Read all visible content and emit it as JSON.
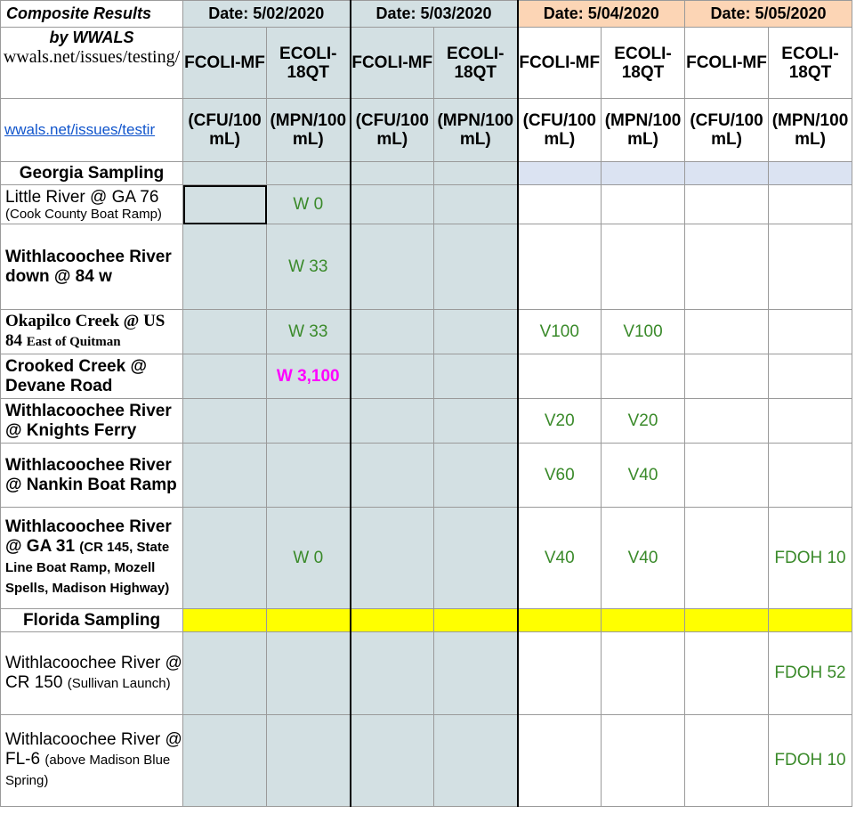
{
  "header": {
    "title": "Composite Results",
    "by_line": "by WWALS",
    "url_text": "wwals.net/issues/testing/",
    "link_text": "wwals.net/issues/testir",
    "dates": [
      "Date:  5/02/2020",
      "Date:  5/03/2020",
      "Date:  5/04/2020",
      "Date:  5/05/2020"
    ],
    "params": [
      "FCOLI-MF",
      "ECOLI-18QT",
      "FCOLI-MF",
      "ECOLI-18QT",
      "FCOLI-MF",
      "ECOLI-18QT",
      "FCOLI-MF",
      "ECOLI-18QT"
    ],
    "units": [
      "(CFU/100 mL)",
      "(MPN/100 mL)",
      "(CFU/100 mL)",
      "(MPN/100 mL)",
      "(CFU/100 mL)",
      "(MPN/100 mL)",
      "(CFU/100 mL)",
      "(MPN/100 mL)"
    ]
  },
  "colors": {
    "blue_column": "#d3e0e3",
    "orange_header": "#fcd5b5",
    "florida_bar": "#ffff00",
    "georgia_bar": "#dbe3f2",
    "value_green": "#3a8a2a",
    "value_magenta": "#ff00ff"
  },
  "sections": {
    "georgia": "Georgia Sampling",
    "florida": "Florida Sampling"
  },
  "sites": [
    {
      "name": "Little River @ GA 76",
      "sub": "(Cook County Boat Ramp)",
      "values": [
        "",
        "W 0",
        "",
        "",
        "",
        "",
        "",
        ""
      ]
    },
    {
      "name": "Withlacoochee River down @ 84 w",
      "sub": "",
      "values": [
        "",
        "W 33",
        "",
        "",
        "",
        "",
        "",
        ""
      ]
    },
    {
      "name": "Okapilco Creek @ US 84",
      "sub": "East of Quitman",
      "values": [
        "",
        "W 33",
        "",
        "",
        "V100",
        "V100",
        "",
        ""
      ]
    },
    {
      "name": "Crooked Creek @ Devane Road",
      "sub": "",
      "values": [
        "",
        "W 3,100",
        "",
        "",
        "",
        "",
        "",
        ""
      ]
    },
    {
      "name": "Withlacoochee River @ Knights Ferry",
      "sub": "",
      "values": [
        "",
        "",
        "",
        "",
        "V20",
        "V20",
        "",
        ""
      ]
    },
    {
      "name": "Withlacoochee River @ Nankin Boat Ramp",
      "sub": "",
      "values": [
        "",
        "",
        "",
        "",
        "V60",
        "V40",
        "",
        ""
      ]
    },
    {
      "name": "Withlacoochee River @ GA 31",
      "sub": "(CR 145, State Line Boat Ramp, Mozell Spells, Madison Highway)",
      "values": [
        "",
        "W 0",
        "",
        "",
        "V40",
        "V40",
        "",
        "FDOH 10"
      ]
    },
    {
      "name": "Withlacoochee River @ CR 150",
      "sub": "(Sullivan Launch)",
      "values": [
        "",
        "",
        "",
        "",
        "",
        "",
        "",
        "FDOH 52"
      ]
    },
    {
      "name": "Withlacoochee River @ FL-6",
      "sub": "(above Madison Blue Spring)",
      "values": [
        "",
        "",
        "",
        "",
        "",
        "",
        "",
        "FDOH 10"
      ]
    }
  ]
}
